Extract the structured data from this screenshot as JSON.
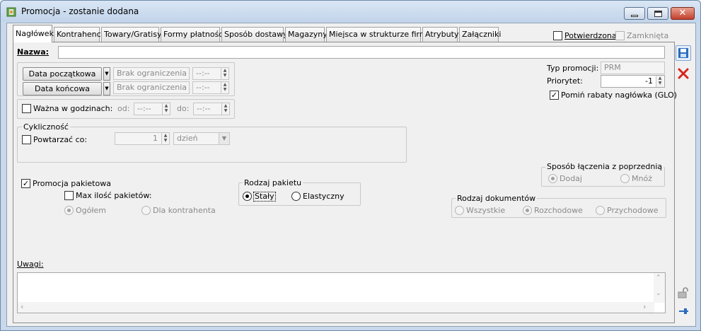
{
  "window": {
    "title": "Promocja - zostanie dodana"
  },
  "tabs": [
    {
      "label": "Nagłówek"
    },
    {
      "label": "Kontrahenci"
    },
    {
      "label": "Towary/Gratisy"
    },
    {
      "label": "Formy płatności"
    },
    {
      "label": "Sposób dostawy"
    },
    {
      "label": "Magazyny"
    },
    {
      "label": "Miejsca w strukturze firmy"
    },
    {
      "label": "Atrybuty"
    },
    {
      "label": "Załączniki"
    }
  ],
  "header_flags": {
    "confirmed_label": "Potwierdzona",
    "confirmed_checked": false,
    "closed_label": "Zamknięta",
    "closed_checked": false
  },
  "name": {
    "label": "Nazwa:",
    "value": ""
  },
  "dates": {
    "start_button": "Data początkowa",
    "start_value": "Brak ograniczenia",
    "start_time": "--:--",
    "end_button": "Data końcowa",
    "end_value": "Brak ograniczenia",
    "end_time": "--:--",
    "hours_label": "Ważna w godzinach:",
    "hours_checked": false,
    "from_label": "od:",
    "from_value": "--:--",
    "to_label": "do:",
    "to_value": "--:--"
  },
  "cyclic": {
    "group_title": "Cykliczność",
    "repeat_label": "Powtarzać co:",
    "repeat_checked": false,
    "repeat_value": "1",
    "unit_value": "dzień"
  },
  "package": {
    "promo_label": "Promocja pakietowa",
    "promo_checked": true,
    "max_label": "Max ilość pakietów:",
    "max_checked": false,
    "overall_label": "Ogółem",
    "overall_selected": true,
    "per_contractor_label": "Dla kontrahenta",
    "per_contractor_selected": false
  },
  "package_type": {
    "group_title": "Rodzaj pakietu",
    "fixed_label": "Stały",
    "fixed_selected": true,
    "flexible_label": "Elastyczny",
    "flexible_selected": false
  },
  "right": {
    "type_label": "Typ promocji:",
    "type_value": "PRM",
    "priority_label": "Priorytet:",
    "priority_value": "-1",
    "skip_label": "Pomiń rabaty nagłówka (GLO)",
    "skip_checked": true
  },
  "join": {
    "group_title": "Sposób łączenia z poprzednią",
    "add_label": "Dodaj",
    "add_selected": true,
    "multiply_label": "Mnóż",
    "multiply_selected": false
  },
  "doc_type": {
    "group_title": "Rodzaj dokumentów",
    "all_label": "Wszystkie",
    "all_selected": false,
    "outgoing_label": "Rozchodowe",
    "outgoing_selected": true,
    "incoming_label": "Przychodowe",
    "incoming_selected": false
  },
  "notes": {
    "label": "Uwagi:",
    "value": ""
  },
  "colors": {
    "save_icon": "#2a6bbf",
    "delete_icon": "#d8261b"
  }
}
